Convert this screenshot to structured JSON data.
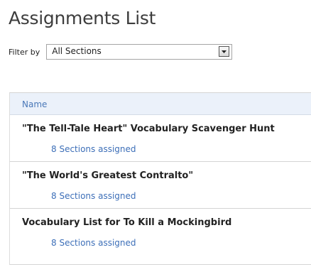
{
  "page": {
    "title": "Assignments List"
  },
  "filter": {
    "label": "Filter by",
    "selected": "All Sections"
  },
  "list": {
    "column_header": "Name",
    "rows": [
      {
        "title": "\"The Tell-Tale Heart\" Vocabulary Scavenger Hunt",
        "sections": "8 Sections assigned"
      },
      {
        "title": "\"The World's Greatest Contralto\"",
        "sections": "8 Sections assigned"
      },
      {
        "title": "Vocabulary List for To Kill a Mockingbird",
        "sections": "8 Sections assigned"
      }
    ]
  },
  "icons": {
    "dropdown": "chevron-down-icon"
  }
}
